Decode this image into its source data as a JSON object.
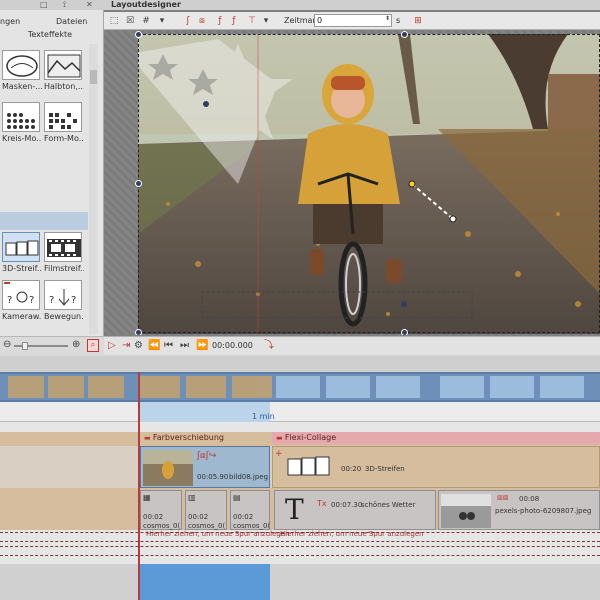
{
  "left_panel": {
    "tabs": [
      "ngen",
      "Dateien"
    ],
    "subtab": "Texteffekte",
    "effects": [
      {
        "label": "Masken-...",
        "icon": "mask-effect-icon"
      },
      {
        "label": "Halbton,...",
        "icon": "halftone-effect-icon"
      },
      {
        "label": "Kreis-Mo...",
        "icon": "circle-mosaic-effect-icon"
      },
      {
        "label": "Form-Mo...",
        "icon": "shape-mosaic-effect-icon"
      },
      {
        "label": "3D-Streif...",
        "icon": "3d-stripes-effect-icon"
      },
      {
        "label": "Filmstreif...",
        "icon": "filmstrip-effect-icon"
      },
      {
        "label": "Kameraw...",
        "icon": "camera-effect-icon"
      },
      {
        "label": "Bewegun...",
        "icon": "motion-effect-icon"
      }
    ]
  },
  "designer": {
    "title": "Layoutdesigner",
    "zeitmarke_label": "Zeitmarke:",
    "zeitmarke_value": "0",
    "zeitmarke_unit": "s",
    "timecode": "00:00.000"
  },
  "timeline": {
    "one_min_label": "1 min",
    "section1_label": "Farbverschiebung",
    "section2_label": "Flexi-Collage",
    "clip_bild08": {
      "time": "00:05.90",
      "name": "bild08.jpeg"
    },
    "clip_3d": {
      "time": "00:20",
      "name": "3D-Streifen"
    },
    "cosmos": [
      {
        "time": "00:02",
        "name": "cosmos_0("
      },
      {
        "time": "00:02",
        "name": "cosmos_0("
      },
      {
        "time": "00:02",
        "name": "cosmos_0("
      }
    ],
    "text_clip": {
      "time": "00:07.30",
      "name": "schönes Wetter"
    },
    "pexels_clip": {
      "time": "00:08",
      "name": "pexels-photo-6209807.jpeg"
    },
    "drop_hint_1": "Hierher ziehen, um neue Spur anzulegen",
    "drop_hint_2": "Hierher ziehen, um neue Spur anzulegen"
  },
  "colors": {
    "accent_red": "#c0392b",
    "selection_blue": "#5b9ad6",
    "track_brown": "#d6bd9e"
  }
}
